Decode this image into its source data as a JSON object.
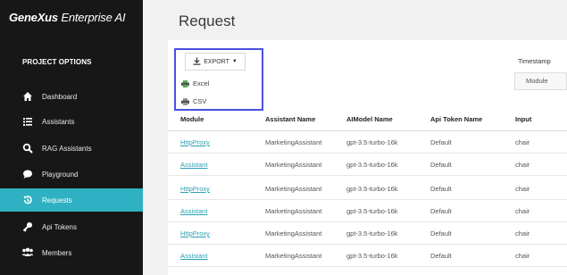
{
  "sidebar": {
    "logo_brand": "GeneXus",
    "logo_rest": " Enterprise AI",
    "section_title": "PROJECT OPTIONS",
    "items": [
      {
        "label": "Dashboard",
        "icon": "home-icon"
      },
      {
        "label": "Assistants",
        "icon": "list-icon"
      },
      {
        "label": "RAG Assistants",
        "icon": "search-icon"
      },
      {
        "label": "Playground",
        "icon": "chat-bubble-icon"
      },
      {
        "label": "Requests",
        "icon": "history-icon",
        "active": true
      },
      {
        "label": "Api Tokens",
        "icon": "key-icon"
      },
      {
        "label": "Members",
        "icon": "users-icon"
      }
    ]
  },
  "main": {
    "title": "Request",
    "export": {
      "label": "EXPORT",
      "options": [
        {
          "label": "Excel",
          "icon": "printer-icon"
        },
        {
          "label": "CSV",
          "icon": "printer-icon"
        }
      ]
    },
    "timestamp": {
      "label": "Timestamp",
      "selected": "Module"
    },
    "table": {
      "columns": [
        "Module",
        "Assistant Name",
        "AIModel Name",
        "Api Token Name",
        "Input"
      ],
      "rows": [
        [
          "HttpProxy",
          "MarketingAssistant",
          "gpt-3.5-turbo-16k",
          "Default",
          "chair"
        ],
        [
          "Assistant",
          "MarketingAssistant",
          "gpt-3.5-turbo-16k",
          "Default",
          "chair"
        ],
        [
          "HttpProxy",
          "MarketingAssistant",
          "gpt-3.5-turbo-16k",
          "Default",
          "chair"
        ],
        [
          "Assistant",
          "MarketingAssistant",
          "gpt-3.5-turbo-16k",
          "Default",
          "chair"
        ],
        [
          "HttpProxy",
          "MarketingAssistant",
          "gpt-3.5-turbo-16k",
          "Default",
          "chair"
        ],
        [
          "Assistant",
          "MarketingAssistant",
          "gpt-3.5-turbo-16k",
          "Default",
          "chair"
        ]
      ]
    }
  },
  "colors": {
    "sidebar_bg": "#171717",
    "active_item": "#2fb1c3",
    "link": "#2b9fb4",
    "export_highlight": "#4a4fe0"
  }
}
